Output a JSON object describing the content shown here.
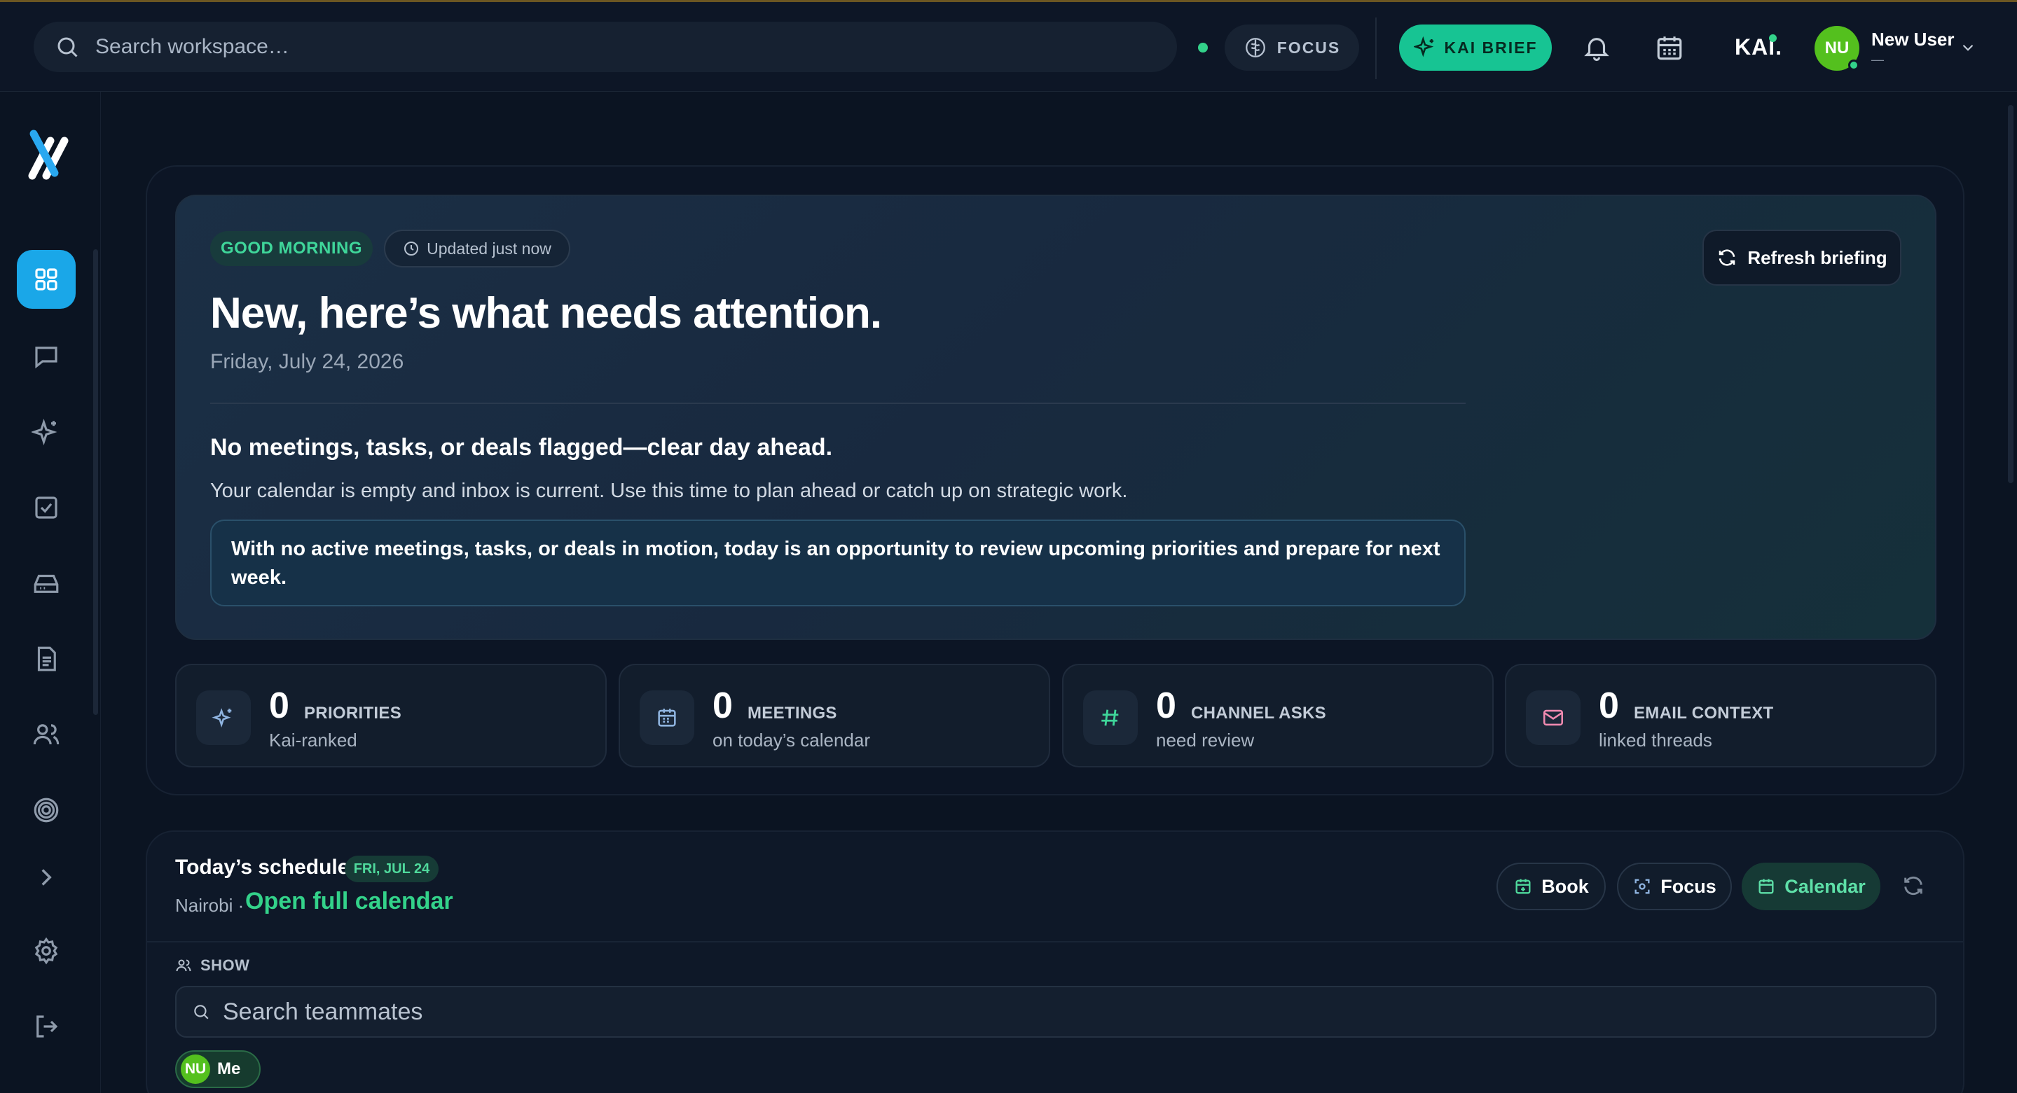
{
  "topbar": {
    "search_placeholder": "Search workspace…",
    "focus_label": "FOCUS",
    "brief_label": "KAI BRIEF",
    "brand": "KAI.",
    "user": {
      "initials": "NU",
      "name": "New User",
      "sub": "—"
    }
  },
  "colors": {
    "accent": "#17c493",
    "sidebar_active": "#1aa7e8",
    "avatar": "#54c01e",
    "online": "#33d28a"
  },
  "sidebar": {
    "items": [
      {
        "name": "dashboard-icon",
        "active": true
      },
      {
        "name": "chat-icon"
      },
      {
        "name": "sparkle-icon"
      },
      {
        "name": "tasks-icon"
      },
      {
        "name": "inbox-icon"
      },
      {
        "name": "document-icon"
      },
      {
        "name": "users-icon"
      },
      {
        "name": "target-icon"
      },
      {
        "name": "chevron-right-icon"
      },
      {
        "name": "settings-icon"
      },
      {
        "name": "logout-icon"
      }
    ]
  },
  "briefing": {
    "greeting": "GOOD MORNING",
    "updated": "Updated just now",
    "refresh_label": "Refresh briefing",
    "title": "New, here’s what needs attention.",
    "date": "Friday, July 24, 2026",
    "summary": "No meetings, tasks, or deals flagged—clear day ahead.",
    "description": "Your calendar is empty and inbox is current. Use this time to plan ahead or catch up on strategic work.",
    "note": "With no active meetings, tasks, or deals in motion, today is an opportunity to review upcoming priorities and prepare for next week."
  },
  "stats": [
    {
      "value": "0",
      "label": "PRIORITIES",
      "sub": "Kai-ranked",
      "icon": "sparkle-icon"
    },
    {
      "value": "0",
      "label": "MEETINGS",
      "sub": "on today’s calendar",
      "icon": "calendar-icon"
    },
    {
      "value": "0",
      "label": "CHANNEL ASKS",
      "sub": "need review",
      "icon": "hash-icon"
    },
    {
      "value": "0",
      "label": "EMAIL CONTEXT",
      "sub": "linked threads",
      "icon": "mail-icon"
    }
  ],
  "schedule": {
    "title": "Today’s schedule",
    "date_chip": "FRI, JUL 24",
    "location": "Nairobi ·",
    "link": "Open full calendar",
    "book_label": "Book",
    "focus_label": "Focus",
    "calendar_label": "Calendar",
    "show_label": "SHOW",
    "search_placeholder": "Search teammates",
    "me": {
      "initials": "NU",
      "label": "Me"
    }
  }
}
